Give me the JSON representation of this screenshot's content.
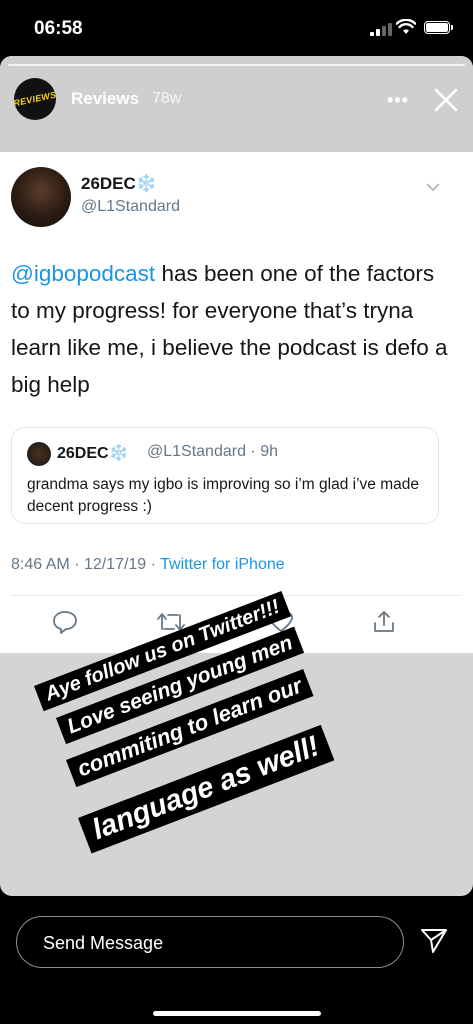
{
  "status_bar": {
    "time": "06:58"
  },
  "story": {
    "user": "Reviews",
    "age": "78w",
    "avatar_text": "REVIEWS",
    "more_icon": "more-horizontal-icon",
    "close_icon": "close-icon"
  },
  "tweet": {
    "name": "26DEC",
    "name_emoji": "❄️",
    "handle": "@L1Standard",
    "mention": "@igbopodcast",
    "body": " has been one of the factors to my progress! for everyone that’s tryna learn like me, i believe the podcast is defo a big help",
    "quote": {
      "name": "26DEC",
      "name_emoji": "❄️",
      "handle_time": "@L1Standard · 9h",
      "text": "grandma says my igbo is improving so i’m glad i’ve made decent progress :)"
    },
    "timestamp": "8:46 AM · 12/17/19 · ",
    "source": "Twitter for iPhone",
    "actions": [
      "reply-icon",
      "retweet-icon",
      "like-icon",
      "share-icon"
    ]
  },
  "overlay": {
    "line1": "Aye follow us on Twitter!!!",
    "line2": "Love seeing young men",
    "line3": "commiting to learn our",
    "line4": "language as well!"
  },
  "footer": {
    "message_placeholder": "Send Message",
    "send_icon": "send-icon"
  },
  "colors": {
    "link_blue": "#1b95e0",
    "muted_gray": "#657786",
    "story_bg": "#d4d4d4"
  }
}
